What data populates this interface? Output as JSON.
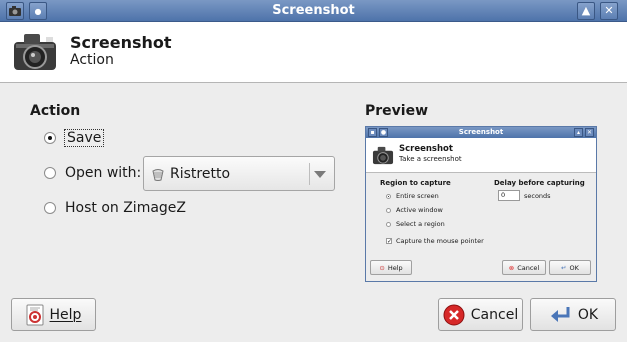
{
  "window": {
    "title": "Screenshot",
    "menu_icon": "camera-icon",
    "pin_glyph": "●",
    "maximize_glyph": "🡅",
    "close_glyph": "✕"
  },
  "header": {
    "title": "Screenshot",
    "subtitle": "Action"
  },
  "action": {
    "section_title": "Action",
    "options": [
      {
        "label": "Save",
        "selected": true
      },
      {
        "label": "Open with:",
        "selected": false
      },
      {
        "label": "Host on ZimageZ",
        "selected": false
      }
    ],
    "open_with_value": "Ristretto"
  },
  "preview": {
    "section_title": "Preview",
    "window_title": "Screenshot",
    "header_title": "Screenshot",
    "header_subtitle": "Take a screenshot",
    "region_title": "Region to capture",
    "region_options": [
      "Entire screen",
      "Active window",
      "Select a region"
    ],
    "capture_pointer": "Capture the mouse pointer",
    "delay_title": "Delay before capturing",
    "delay_value": "0",
    "delay_unit": "seconds",
    "help": "Help",
    "cancel": "Cancel",
    "ok": "OK"
  },
  "buttons": {
    "help": "Help",
    "cancel": "Cancel",
    "ok": "OK"
  },
  "colors": {
    "titlebar": "#5a7eb3",
    "cancel_icon": "#d62828",
    "ok_icon": "#4a76b8"
  }
}
